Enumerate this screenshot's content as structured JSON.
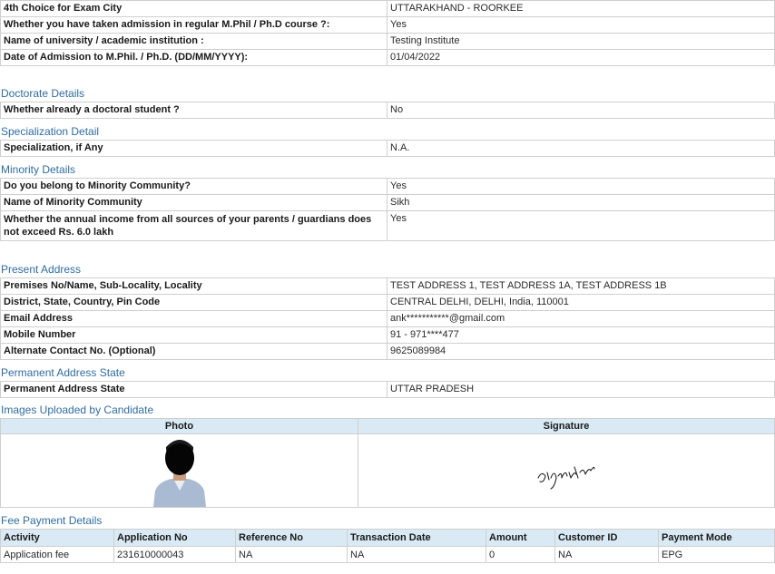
{
  "top_rows": [
    {
      "label": "4th Choice for Exam City",
      "value": "UTTARAKHAND - ROORKEE"
    },
    {
      "label": "Whether you have taken admission in regular M.Phil / Ph.D course ?:",
      "value": "Yes"
    },
    {
      "label": "Name of university / academic institution :",
      "value": "Testing Institute"
    },
    {
      "label": "Date of Admission to M.Phil. / Ph.D. (DD/MM/YYYY):",
      "value": "01/04/2022"
    }
  ],
  "doctorate": {
    "title": "Doctorate Details",
    "rows": [
      {
        "label": "Whether already a doctoral student ?",
        "value": "No"
      }
    ]
  },
  "specialization": {
    "title": "Specialization Detail",
    "rows": [
      {
        "label": "Specialization, if Any",
        "value": "N.A."
      }
    ]
  },
  "minority": {
    "title": "Minority Details",
    "rows": [
      {
        "label": "Do you belong to Minority Community?",
        "value": "Yes"
      },
      {
        "label": "Name of Minority Community",
        "value": "Sikh"
      },
      {
        "label": "Whether the annual income from all sources of your parents / guardians does not exceed Rs. 6.0 lakh",
        "value": "Yes"
      }
    ]
  },
  "present_address": {
    "title": "Present Address",
    "rows": [
      {
        "label": "Premises No/Name, Sub-Locality, Locality",
        "value": "TEST ADDRESS 1, TEST ADDRESS 1A, TEST ADDRESS 1B"
      },
      {
        "label": "District, State, Country, Pin Code",
        "value": "CENTRAL DELHI, DELHI, India, 110001"
      },
      {
        "label": "Email Address",
        "value": "ank***********@gmail.com"
      },
      {
        "label": "Mobile Number",
        "value": "91 - 971****477"
      },
      {
        "label": "Alternate Contact No. (Optional)",
        "value": "9625089984"
      }
    ]
  },
  "permanent": {
    "title": "Permanent Address State",
    "rows": [
      {
        "label": "Permanent Address State",
        "value": "UTTAR PRADESH"
      }
    ]
  },
  "images": {
    "title": "Images Uploaded by Candidate",
    "photo_header": "Photo",
    "signature_header": "Signature",
    "signature_text": "signature"
  },
  "fee": {
    "title": "Fee Payment Details",
    "headers": [
      "Activity",
      "Application No",
      "Reference No",
      "Transaction Date",
      "Amount",
      "Customer ID",
      "Payment Mode"
    ],
    "row": [
      "Application fee",
      "231610000043",
      "NA",
      "NA",
      "0",
      "NA",
      "EPG"
    ]
  }
}
